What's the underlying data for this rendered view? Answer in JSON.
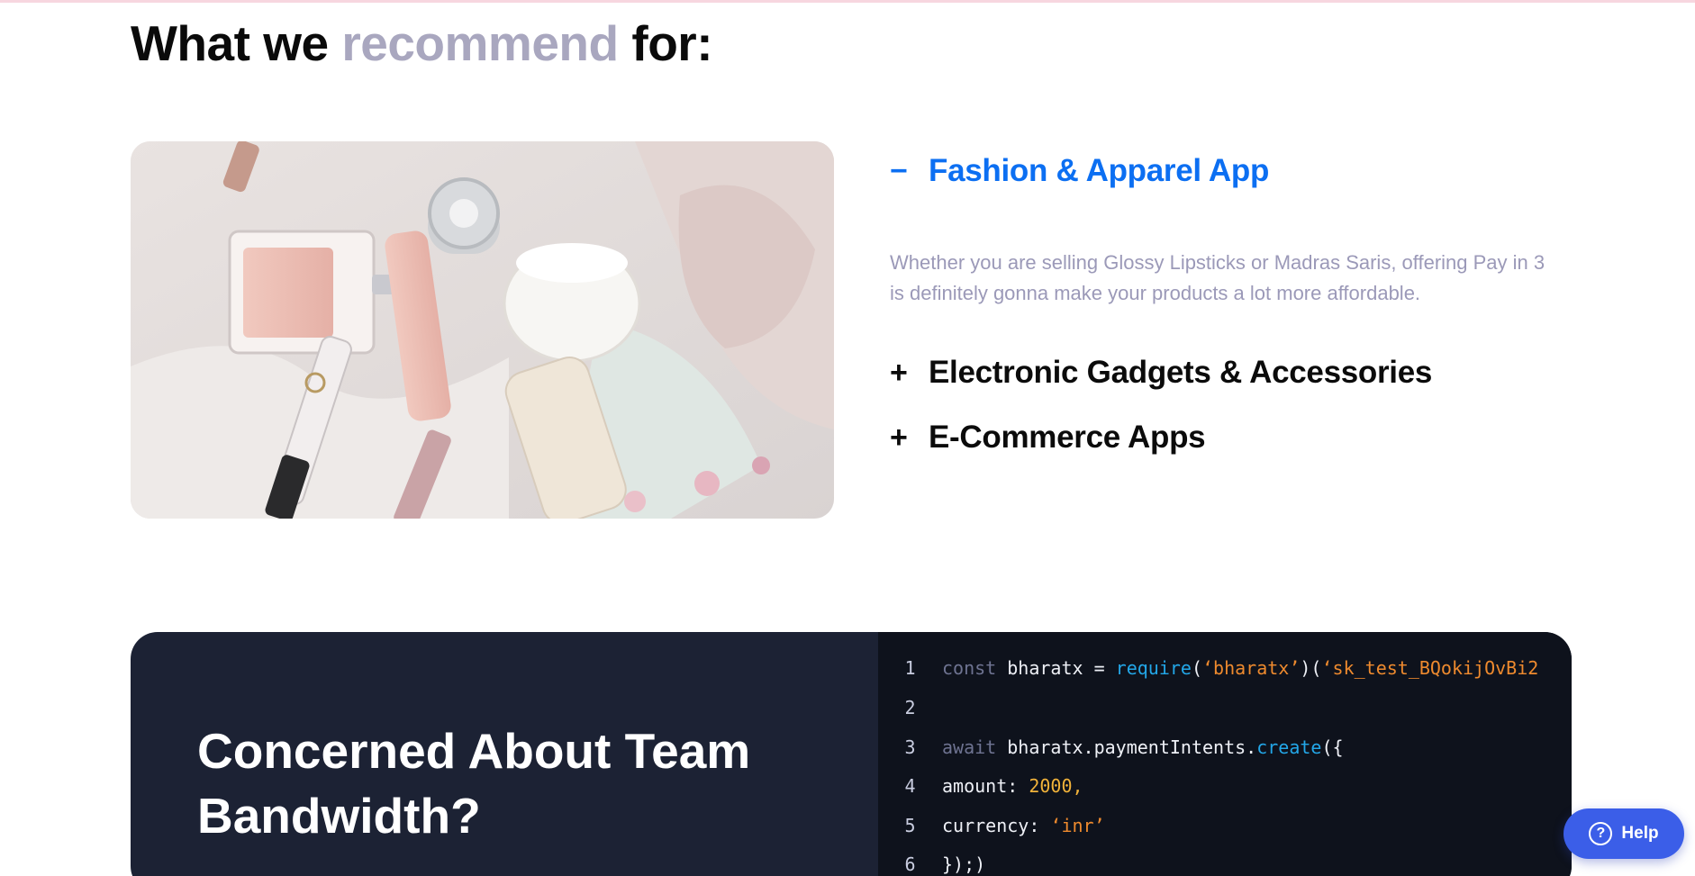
{
  "section": {
    "heading_part1": "What we",
    "heading_accent": "recommend",
    "heading_part2": "for:"
  },
  "photo": {
    "alt": "cosmetics and lipsticks flat lay"
  },
  "accordion": [
    {
      "icon": "−",
      "title": "Fashion & Apparel App",
      "expanded": true,
      "description": "Whether you are selling Glossy Lipsticks or Madras Saris, offering Pay in 3 is definitely gonna make your products a lot more affordable."
    },
    {
      "icon": "+",
      "title": "Electronic Gadgets & Accessories",
      "expanded": false
    },
    {
      "icon": "+",
      "title": "E-Commerce Apps",
      "expanded": false
    }
  ],
  "team_section": {
    "title": "Concerned About Team Bandwidth?"
  },
  "code": {
    "lines": [
      {
        "n": "1",
        "kw": "const",
        "a": " bharatx = ",
        "fn": "require",
        "b": "(",
        "s1": "‘bharatx’",
        "c": ")(",
        "s2": "‘sk_test_BQokijOvBi2"
      },
      {
        "n": "2"
      },
      {
        "n": "3",
        "kw": "await",
        "a": " bharatx.paymentIntents.",
        "fn": "create",
        "b": "({"
      },
      {
        "n": "4",
        "a": "amount: ",
        "num": "2000",
        "b": ","
      },
      {
        "n": "5",
        "a": "currency: ",
        "s1": "‘inr’"
      },
      {
        "n": "6",
        "a": "});)"
      }
    ]
  },
  "help": {
    "label": "Help",
    "icon": "help-circle-icon"
  },
  "colors": {
    "accent_blue": "#0c6ff2",
    "muted_purple": "#a9a7bf",
    "dark_card": "#1c2234",
    "help_button": "#3b5ee8"
  }
}
